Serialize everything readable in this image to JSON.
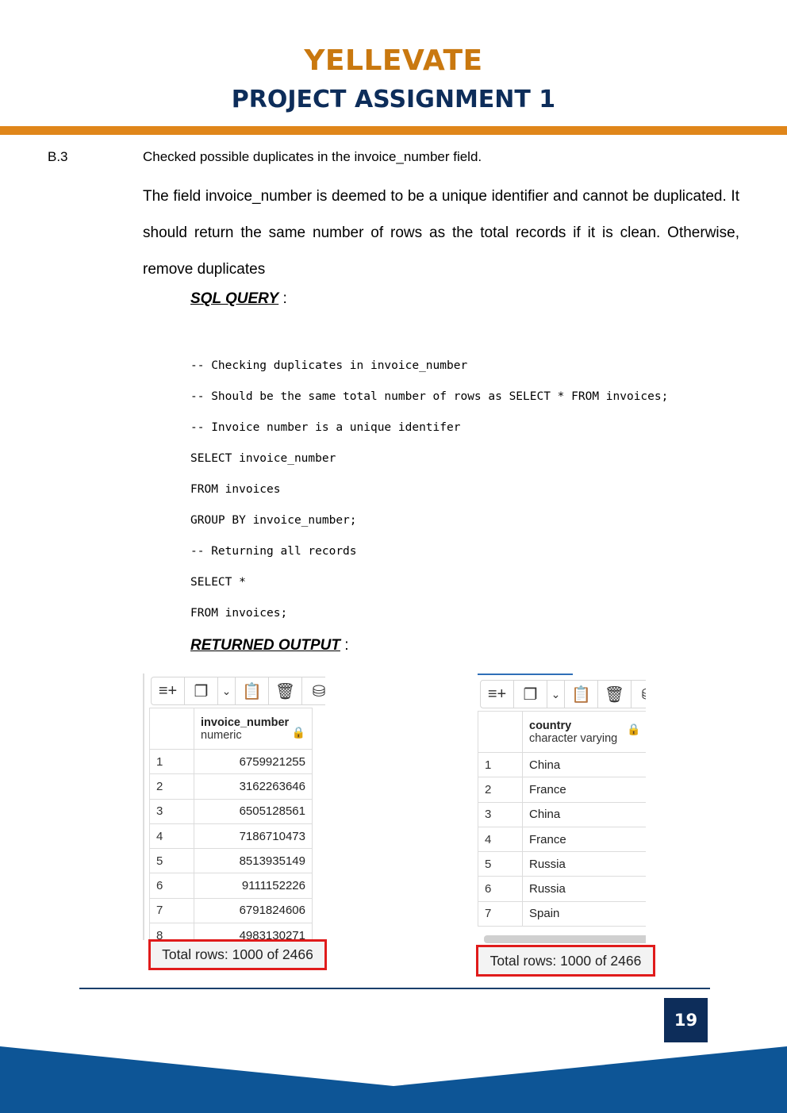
{
  "header": {
    "brand": "YELLEVATE",
    "subtitle": "PROJECT ASSIGNMENT 1",
    "colors": {
      "brand": "#c9780f",
      "navy": "#0d2d5a",
      "accent_bar": "#e0861a"
    }
  },
  "section": {
    "number": "B.3",
    "title": "Checked possible duplicates in the invoice_number field.",
    "paragraph": "The field invoice_number is deemed to be a unique identifier and cannot be duplicated. It should return the same number of rows as the total records if it is clean. Otherwise, remove duplicates"
  },
  "sql": {
    "heading": "SQL QUERY",
    "lines": [
      "-- Checking duplicates in invoice_number",
      "-- Should be the same total number of rows as SELECT * FROM invoices;",
      "-- Invoice number is a unique identifer",
      "SELECT invoice_number",
      "FROM invoices",
      "GROUP BY invoice_number;",
      "-- Returning all records",
      "SELECT *",
      "FROM invoices;"
    ]
  },
  "output": {
    "heading": "RETURNED OUTPUT",
    "left": {
      "column": "invoice_number",
      "type": "numeric",
      "rows": [
        [
          "1",
          "6759921255"
        ],
        [
          "2",
          "3162263646"
        ],
        [
          "3",
          "6505128561"
        ],
        [
          "4",
          "7186710473"
        ],
        [
          "5",
          "8513935149"
        ],
        [
          "6",
          "9111152226"
        ],
        [
          "7",
          "6791824606"
        ],
        [
          "8",
          "4983130271"
        ]
      ],
      "total": "Total rows: 1000 of 2466"
    },
    "right": {
      "column": "country",
      "type": "character varying",
      "rows": [
        [
          "1",
          "China"
        ],
        [
          "2",
          "France"
        ],
        [
          "3",
          "China"
        ],
        [
          "4",
          "France"
        ],
        [
          "5",
          "Russia"
        ],
        [
          "6",
          "Russia"
        ],
        [
          "7",
          "Spain"
        ]
      ],
      "total": "Total rows: 1000 of 2466"
    },
    "toolbar_icons": [
      "add-row-icon",
      "copy-icon",
      "chevron-down-icon",
      "paste-icon",
      "delete-icon",
      "database-icon"
    ]
  },
  "footer": {
    "page_number": "19"
  }
}
